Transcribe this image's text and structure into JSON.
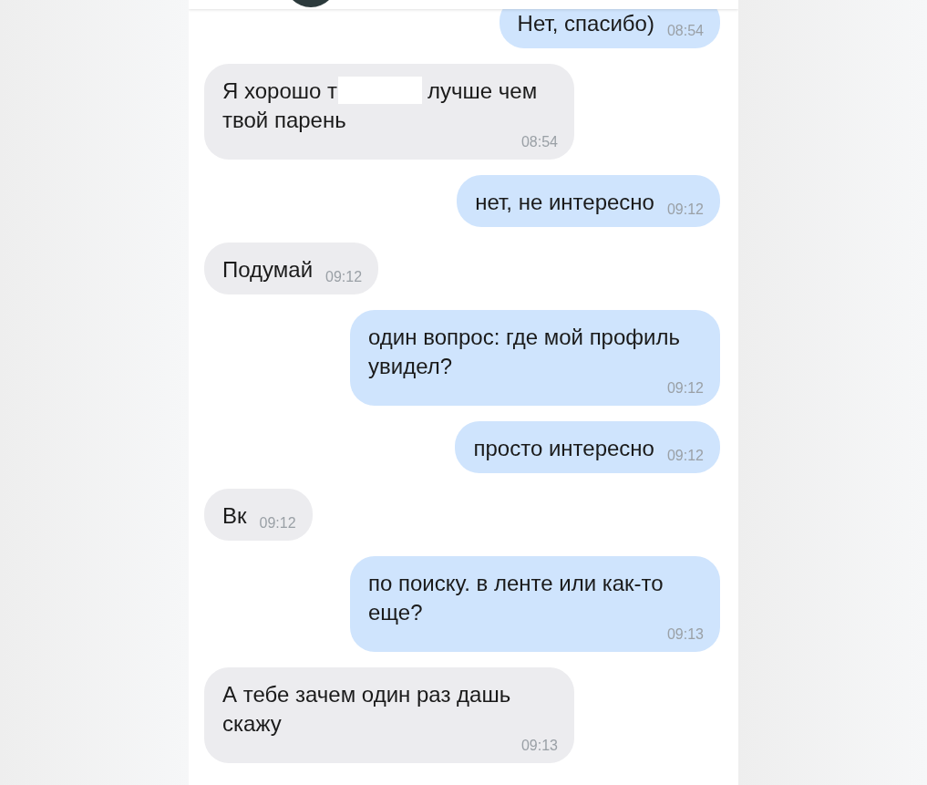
{
  "messages": [
    {
      "kind": "out",
      "text": "Нет, спасибо)",
      "time": "08:54"
    },
    {
      "kind": "in",
      "text": "Я хорошо т",
      "redacted": true,
      "text_after": "лучше чем твой парень",
      "time": "08:54"
    },
    {
      "kind": "out",
      "text": "нет, не интересно",
      "time": "09:12"
    },
    {
      "kind": "in",
      "text": "Подумай",
      "time": "09:12"
    },
    {
      "kind": "out",
      "text": "один вопрос: где мой профиль увидел?",
      "time": "09:12"
    },
    {
      "kind": "out",
      "text": "просто интересно",
      "time": "09:12"
    },
    {
      "kind": "in",
      "text": "Вк",
      "time": "09:12"
    },
    {
      "kind": "out",
      "text": "по поиску. в ленте или как-то еще?",
      "time": "09:13"
    },
    {
      "kind": "in",
      "text": "А тебе зачем один раз дашь скажу",
      "time": "09:13"
    }
  ]
}
